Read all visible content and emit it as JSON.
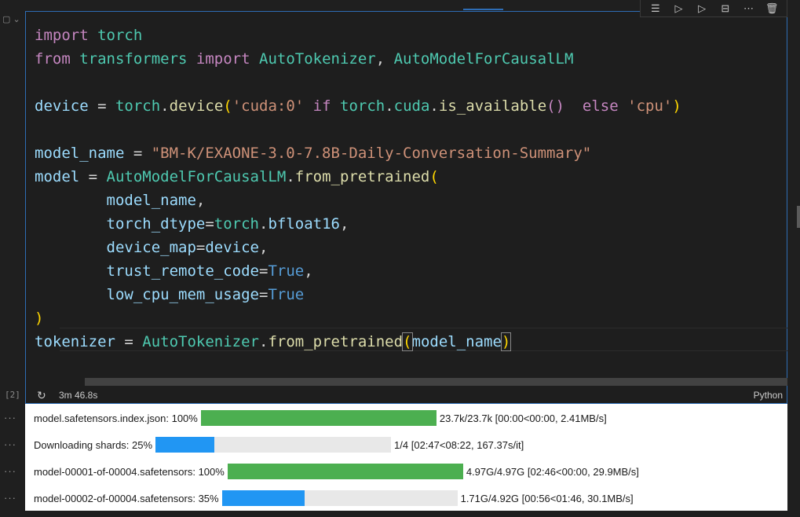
{
  "cell": {
    "execution_count": "[2]",
    "exec_time": "3m 46.8s",
    "language": "Python"
  },
  "toolbar": {
    "buttons": [
      {
        "name": "run-by-line-icon",
        "glyph": "☰"
      },
      {
        "name": "execute-above-icon",
        "glyph": "▷"
      },
      {
        "name": "execute-below-icon",
        "glyph": "▷"
      },
      {
        "name": "split-cell-icon",
        "glyph": "⊟"
      },
      {
        "name": "more-actions-icon",
        "glyph": "⋯"
      },
      {
        "name": "delete-icon",
        "glyph": "🗑"
      }
    ]
  },
  "code_lines": [
    [
      {
        "t": "import",
        "c": "kw"
      },
      {
        "t": " torch",
        "c": "mod"
      }
    ],
    [
      {
        "t": "from",
        "c": "kw"
      },
      {
        "t": " transformers ",
        "c": "mod"
      },
      {
        "t": "import",
        "c": "kw"
      },
      {
        "t": " AutoTokenizer",
        "c": "mod"
      },
      {
        "t": ", ",
        "c": ""
      },
      {
        "t": "AutoModelForCausalLM",
        "c": "mod"
      }
    ],
    [],
    [
      {
        "t": "device",
        "c": "var"
      },
      {
        "t": " = ",
        "c": ""
      },
      {
        "t": "torch",
        "c": "mod"
      },
      {
        "t": ".",
        "c": ""
      },
      {
        "t": "device",
        "c": "fn"
      },
      {
        "t": "(",
        "c": "paren"
      },
      {
        "t": "'cuda:0'",
        "c": "str"
      },
      {
        "t": " if ",
        "c": "kw"
      },
      {
        "t": "torch",
        "c": "mod"
      },
      {
        "t": ".",
        "c": ""
      },
      {
        "t": "cuda",
        "c": "mod"
      },
      {
        "t": ".",
        "c": ""
      },
      {
        "t": "is_available",
        "c": "fn"
      },
      {
        "t": "()",
        "c": "kw"
      },
      {
        "t": "  else ",
        "c": "kw"
      },
      {
        "t": "'cpu'",
        "c": "str"
      },
      {
        "t": ")",
        "c": "paren"
      }
    ],
    [],
    [
      {
        "t": "model_name",
        "c": "var"
      },
      {
        "t": " = ",
        "c": ""
      },
      {
        "t": "\"BM-K/EXAONE-3.0-7.8B-Daily-Conversation-Summary\"",
        "c": "str"
      }
    ],
    [
      {
        "t": "model",
        "c": "var"
      },
      {
        "t": " = ",
        "c": ""
      },
      {
        "t": "AutoModelForCausalLM",
        "c": "mod"
      },
      {
        "t": ".",
        "c": ""
      },
      {
        "t": "from_pretrained",
        "c": "fn"
      },
      {
        "t": "(",
        "c": "paren"
      }
    ],
    [
      {
        "t": "        model_name",
        "c": "var"
      },
      {
        "t": ",",
        "c": ""
      }
    ],
    [
      {
        "t": "        torch_dtype",
        "c": "var"
      },
      {
        "t": "=",
        "c": ""
      },
      {
        "t": "torch",
        "c": "mod"
      },
      {
        "t": ".",
        "c": ""
      },
      {
        "t": "bfloat16",
        "c": "var"
      },
      {
        "t": ",",
        "c": ""
      }
    ],
    [
      {
        "t": "        device_map",
        "c": "var"
      },
      {
        "t": "=",
        "c": ""
      },
      {
        "t": "device",
        "c": "var"
      },
      {
        "t": ",",
        "c": ""
      }
    ],
    [
      {
        "t": "        trust_remote_code",
        "c": "var"
      },
      {
        "t": "=",
        "c": ""
      },
      {
        "t": "True",
        "c": "const"
      },
      {
        "t": ",",
        "c": ""
      }
    ],
    [
      {
        "t": "        low_cpu_mem_usage",
        "c": "var"
      },
      {
        "t": "=",
        "c": ""
      },
      {
        "t": "True",
        "c": "const"
      }
    ],
    [
      {
        "t": ")",
        "c": "paren"
      }
    ],
    [
      {
        "t": "tokenizer",
        "c": "var"
      },
      {
        "t": " = ",
        "c": ""
      },
      {
        "t": "AutoTokenizer",
        "c": "mod"
      },
      {
        "t": ".",
        "c": ""
      },
      {
        "t": "from_pretrained",
        "c": "fn"
      },
      {
        "t": "(",
        "c": "paren match"
      },
      {
        "t": "model_name",
        "c": "var"
      },
      {
        "t": ")",
        "c": "paren match"
      }
    ]
  ],
  "output": {
    "progress": [
      {
        "label": "model.safetensors.index.json: 100%",
        "fraction": 1.0,
        "status": "done",
        "stats": "23.7k/23.7k [00:00<00:00, 2.41MB/s]"
      },
      {
        "label": "Downloading shards: 25%",
        "fraction": 0.25,
        "status": "partial",
        "stats": "1/4 [02:47<08:22, 167.37s/it]"
      },
      {
        "label": "model-00001-of-00004.safetensors: 100%",
        "fraction": 1.0,
        "status": "done",
        "stats": "4.97G/4.97G [02:46<00:00, 29.9MB/s]"
      },
      {
        "label": "model-00002-of-00004.safetensors: 35%",
        "fraction": 0.35,
        "status": "partial",
        "stats": "1.71G/4.92G [00:56<01:46, 30.1MB/s]"
      }
    ]
  },
  "colors": {
    "done": "#4caf50",
    "partial": "#2196f3",
    "cell_border": "#2e6db5"
  }
}
